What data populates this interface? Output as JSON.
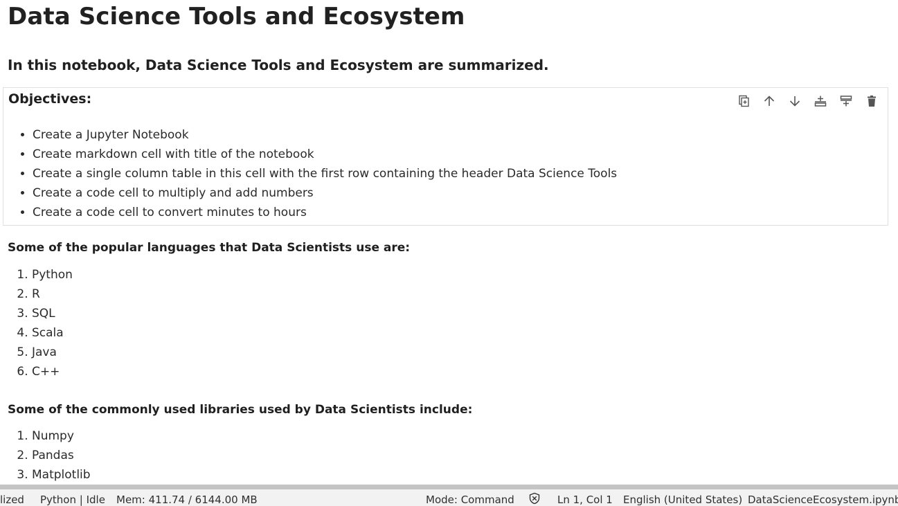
{
  "notebook": {
    "title": "Data Science Tools and Ecosystem",
    "intro": "In this notebook, Data Science Tools and Ecosystem are summarized.",
    "objectives": {
      "heading": "Objectives:",
      "items": [
        "Create a Jupyter Notebook",
        "Create markdown cell with title of the notebook",
        "Create a single column table in this cell with the first row containing the header Data Science Tools",
        "Create a code cell to multiply and add numbers",
        "Create a code cell to convert minutes to hours"
      ]
    },
    "languages": {
      "heading": "Some of the popular languages that Data Scientists use are:",
      "items": [
        "Python",
        "R",
        "SQL",
        "Scala",
        "Java",
        "C++"
      ]
    },
    "libraries": {
      "heading": "Some of the commonly used libraries used by Data Scientists include:",
      "items": [
        "Numpy",
        "Pandas",
        "Matplotlib"
      ]
    }
  },
  "cell_toolbar": {
    "icons": [
      "duplicate-icon",
      "move-up-icon",
      "move-down-icon",
      "insert-above-icon",
      "insert-below-icon",
      "delete-icon"
    ]
  },
  "statusbar": {
    "left_truncated": "lized",
    "kernel": "Python | Idle",
    "memory": "Mem: 411.74 / 6144.00 MB",
    "mode": "Mode: Command",
    "position": "Ln 1, Col 1",
    "language": "English (United States)",
    "filename": "DataScienceEcosystem.ipynb"
  }
}
